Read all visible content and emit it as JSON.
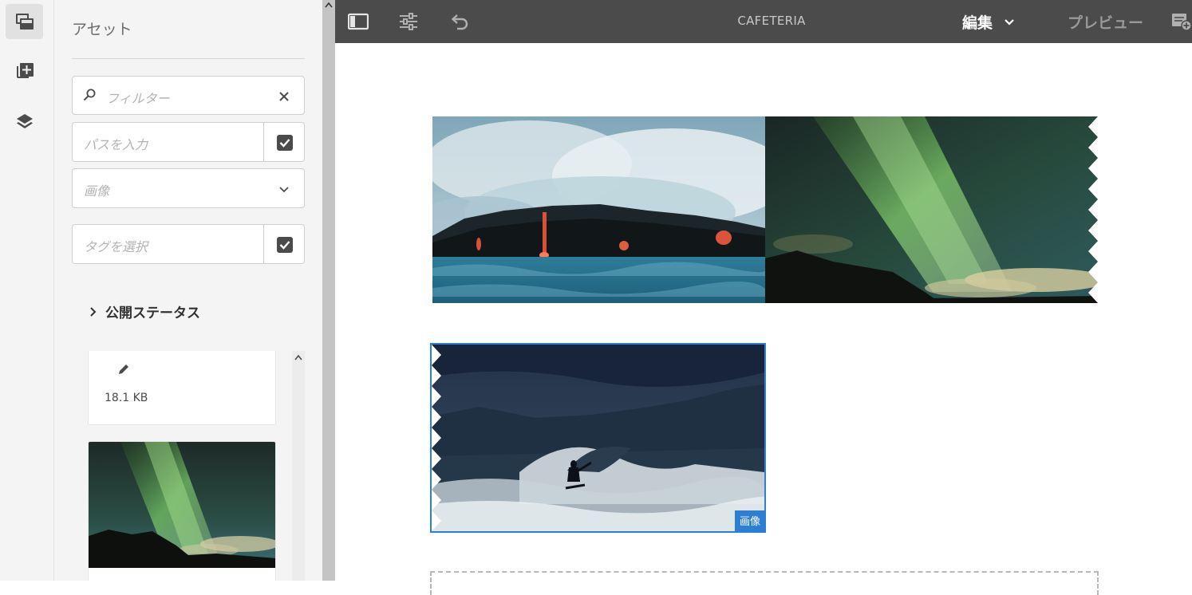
{
  "sidebar": {
    "title": "アセット",
    "rail": [
      {
        "icon": "assets-icon",
        "active": true
      },
      {
        "icon": "components-icon",
        "active": false
      },
      {
        "icon": "layers-icon",
        "active": false
      }
    ],
    "filter": {
      "placeholder": "フィルター"
    },
    "path": {
      "placeholder": "パスを入力"
    },
    "type_select": {
      "value": "画像"
    },
    "tags": {
      "placeholder": "タグを選択"
    },
    "publish_status": {
      "label": "公開ステータス"
    },
    "cards": [
      {
        "size": "18.1 KB"
      },
      {
        "thumbnail": "aurora"
      }
    ]
  },
  "toolbar": {
    "page_title": "CAFETERIA",
    "mode_label": "編集",
    "preview_label": "プレビュー"
  },
  "canvas": {
    "images": [
      {
        "name": "lava-ocean"
      },
      {
        "name": "aurora-mountains"
      },
      {
        "name": "surfer-wave",
        "badge": "画像",
        "selected": true
      }
    ]
  },
  "colors": {
    "toolbar_bg": "#4b4b4b",
    "selection": "#2d7fd3",
    "panel_bg": "#f4f4f4"
  }
}
